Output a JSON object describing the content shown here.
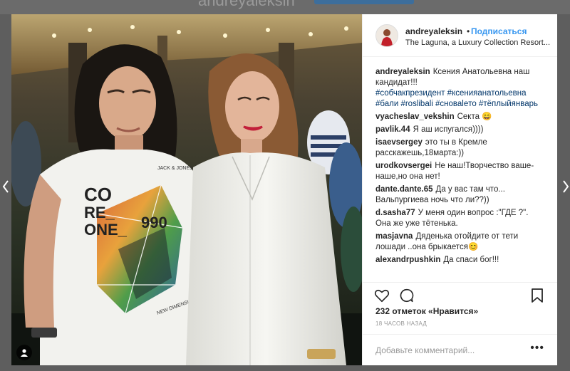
{
  "background_header": {
    "title": "andreyaleksin"
  },
  "post": {
    "username": "andreyaleksin",
    "separator": "•",
    "follow_label": "Подписаться",
    "location": "The Laguna, a Luxury Collection Resort...",
    "caption": {
      "text": "Ксения Анатольевна наш кандидат!!!",
      "hashtags": "#собчакпрезидент #ксенияанатольевна #бали #roslibali #сноваleто #тёплыйянварь"
    },
    "comments": [
      {
        "user": "vyacheslav_vekshin",
        "text": "Секта 😄"
      },
      {
        "user": "pavlik.44",
        "text": "Я аш испугался))))"
      },
      {
        "user": "isaevsergey",
        "text": "это ты в Кремле расскажешь,18марта:))"
      },
      {
        "user": "urodkovsergei",
        "text": "Не наш!Творчество ваше-наше,но она нет!"
      },
      {
        "user": "dante.dante.65",
        "text": "Да у вас там что... Вальпургиева ночь что ли??))"
      },
      {
        "user": "d.sasha77",
        "text": "У меня один вопрос :\"ГДЕ ?\". Она же уже тётенька."
      },
      {
        "user": "masjavna",
        "text": "Дяденька отойдите от тети лошади ..она брыкается😊"
      },
      {
        "user": "alexandrpushkin",
        "text": "Да спаси бог!!!"
      }
    ],
    "likes": "232 отметок «Нравится»",
    "time": "18 ЧАСОВ НАЗАД",
    "add_comment_placeholder": "Добавьте комментарий...",
    "more_label": "•••",
    "shirt_text": {
      "line1": "CO",
      "line2": "RE_",
      "line3": "ONE_",
      "line4": "990",
      "brand": "JACK & JONES",
      "small": "NEW DIMENSIONS"
    }
  },
  "icons": {
    "like": "heart-icon",
    "comment": "comment-bubble-icon",
    "save": "bookmark-icon",
    "tag": "user-tag-icon",
    "prev": "chevron-left-icon",
    "next": "chevron-right-icon"
  },
  "colors": {
    "link": "#3897f0",
    "hashtag": "#003569",
    "text": "#262626",
    "muted": "#999999",
    "overlay": "#5e5e5e"
  }
}
